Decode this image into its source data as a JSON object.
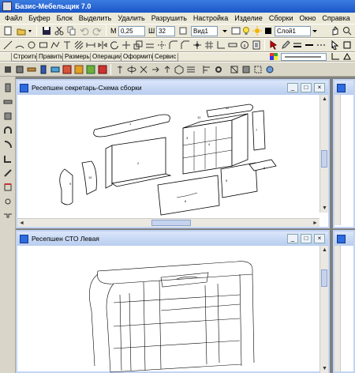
{
  "app": {
    "title": "Базис-Мебельщик 7.0"
  },
  "menu": [
    "Файл",
    "Буфер",
    "Блок",
    "Выделить",
    "Удалить",
    "Разрушить",
    "Настройка",
    "Изделие",
    "Сборки",
    "Окно",
    "Справка"
  ],
  "toolbar": {
    "m_label": "М",
    "m_value": "0,25",
    "grid_label": "Ш",
    "grid_value": "32",
    "view_value": "Вид1",
    "layer_value": "Слой1"
  },
  "tabs": [
    "Строить",
    "Править",
    "Размеры",
    "Операции",
    "Оформить",
    "Сервис"
  ],
  "windows": {
    "assembly": {
      "title": "Ресепшен секретарь-Схема сборки"
    },
    "left": {
      "title": "Ресепшен СТО Левая"
    }
  },
  "colors": {
    "title_bar": "#1c56c7",
    "window_caption": "#c2d4f2",
    "toolbar_bg": "#ece9d8"
  }
}
